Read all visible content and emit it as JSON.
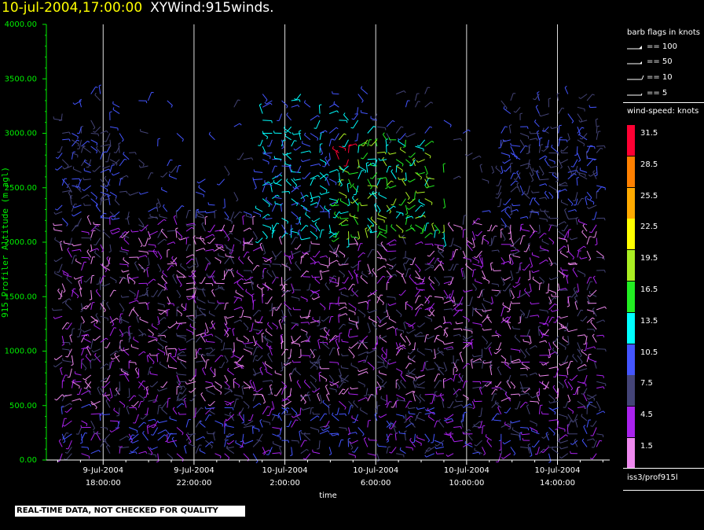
{
  "header": {
    "datetime": "10-jul-2004,17:00:00",
    "product": "XYWind:915winds."
  },
  "chart_data": {
    "type": "scatter",
    "title": "10-jul-2004,17:00:00  XYWind:915winds.",
    "xlabel": "time",
    "ylabel": "915 Profiler Altitude (m agl)",
    "ylim": [
      0,
      4000
    ],
    "y_ticks": [
      "0.00",
      "500.00",
      "1000.00",
      "1500.00",
      "2000.00",
      "2500.00",
      "3000.00",
      "3500.00",
      "4000.00"
    ],
    "x_hours_range": [
      -2.5,
      22.3
    ],
    "x_ticks": [
      {
        "date": "9-Jul-2004",
        "time": "18:00:00"
      },
      {
        "date": "9-Jul-2004",
        "time": "22:00:00"
      },
      {
        "date": "10-Jul-2004",
        "time": "2:00:00"
      },
      {
        "date": "10-Jul-2004",
        "time": "6:00:00"
      },
      {
        "date": "10-Jul-2004",
        "time": "10:00:00"
      },
      {
        "date": "10-Jul-2004",
        "time": "14:00:00"
      }
    ],
    "grid": "vertical lines at labeled ticks",
    "units": "knots"
  },
  "legend": {
    "barb_title": "barb flags in knots",
    "barbs": [
      "== 100",
      "== 50",
      "== 10",
      "== 5"
    ],
    "speed_title": "wind-speed: knots",
    "speed_bins": [
      {
        "label": "31.5",
        "color": "#ff0033"
      },
      {
        "label": "28.5",
        "color": "#ff8000"
      },
      {
        "label": "25.5",
        "color": "#ffaa00"
      },
      {
        "label": "22.5",
        "color": "#ffff00"
      },
      {
        "label": "19.5",
        "color": "#aaee22"
      },
      {
        "label": "16.5",
        "color": "#22ee22"
      },
      {
        "label": "13.5",
        "color": "#00ffff"
      },
      {
        "label": "10.5",
        "color": "#4455ff"
      },
      {
        "label": "7.5",
        "color": "#444477"
      },
      {
        "label": "4.5",
        "color": "#aa22ee"
      },
      {
        "label": "1.5",
        "color": "#ee88ee"
      }
    ],
    "source": "iss3/prof915l"
  },
  "footer": {
    "quality_note": "REAL-TIME DATA, NOT CHECKED FOR QUALITY"
  }
}
